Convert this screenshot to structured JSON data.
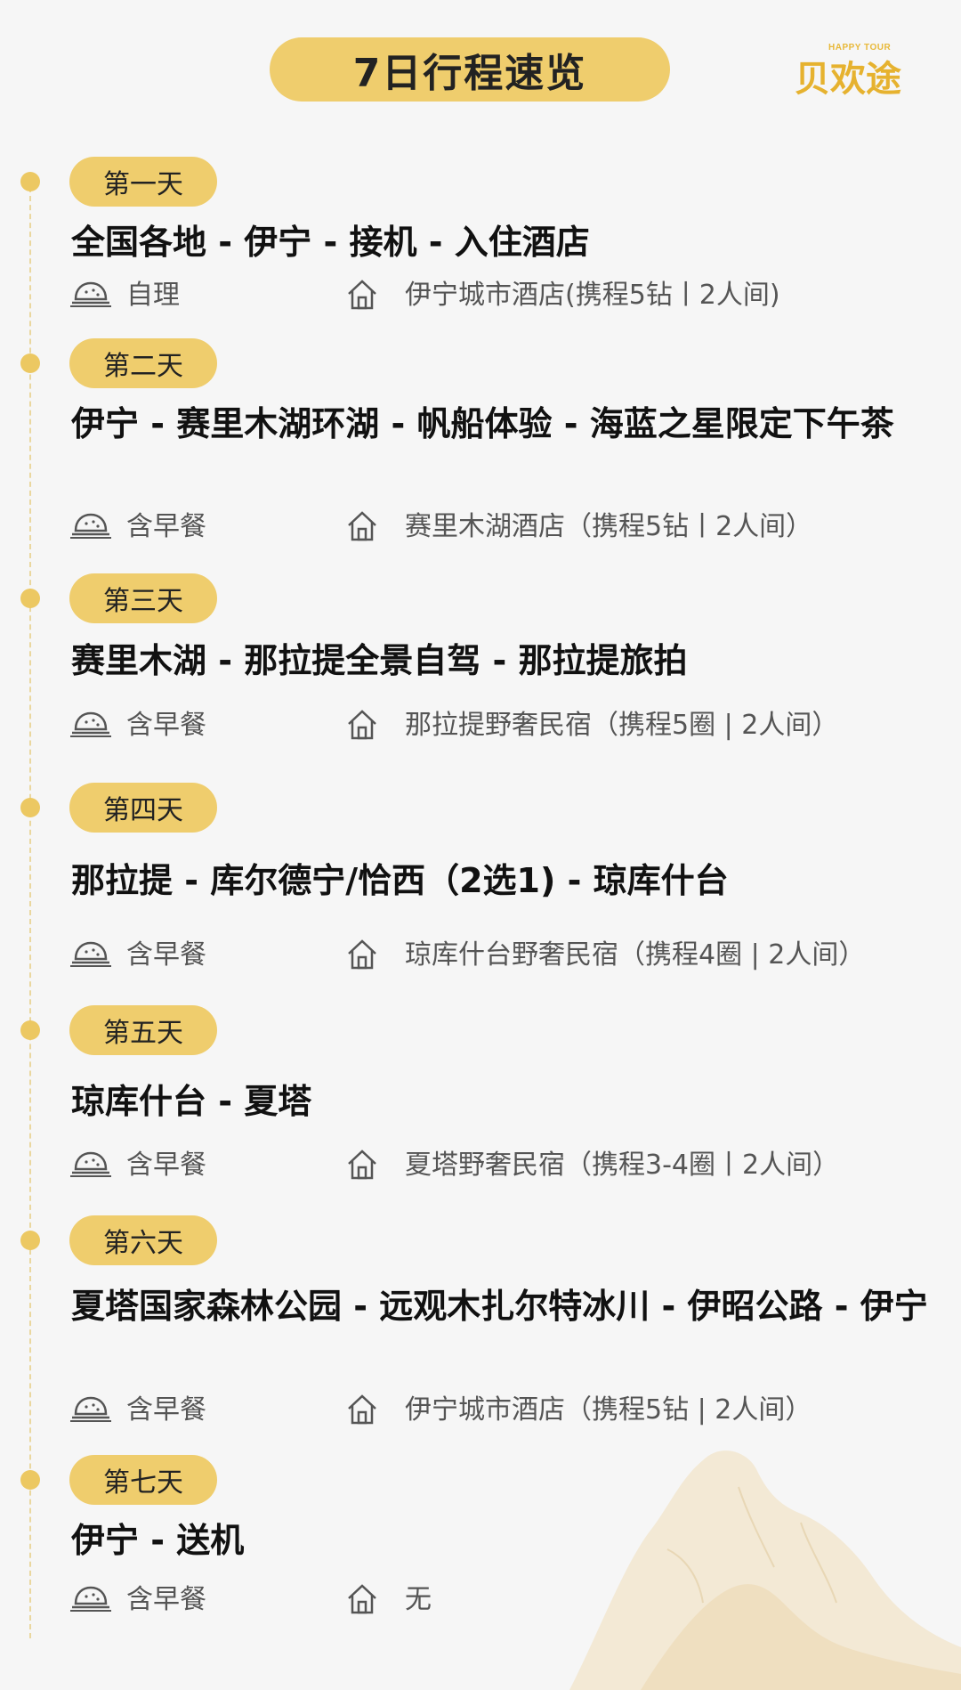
{
  "header": {
    "title": "7日行程速览",
    "logo_small": "HAPPY TOUR",
    "logo_text": "贝欢途"
  },
  "colors": {
    "accent": "#efcd6d",
    "dot": "#ecc862",
    "background": "#f6f6f6"
  },
  "days": [
    {
      "label": "第一天",
      "route": "全国各地 - 伊宁 - 接机 - 入住酒店",
      "meal": "自理",
      "hotel": "伊宁城市酒店(携程5钻丨2人间)"
    },
    {
      "label": "第二天",
      "route": "伊宁 -  赛里木湖环湖 - 帆船体验 - 海蓝之星限定下午茶",
      "meal": "含早餐",
      "hotel": "赛里木湖酒店（携程5钻丨2人间）"
    },
    {
      "label": "第三天",
      "route": "赛里木湖 - 那拉提全景自驾 - 那拉提旅拍",
      "meal": "含早餐",
      "hotel": "那拉提野奢民宿（携程5圈 | 2人间）"
    },
    {
      "label": "第四天",
      "route": "那拉提 - 库尔德宁/恰西（2选1) - 琼库什台",
      "meal": "含早餐",
      "hotel": "琼库什台野奢民宿（携程4圈  | 2人间）"
    },
    {
      "label": "第五天",
      "route": "琼库什台 - 夏塔",
      "meal": "含早餐",
      "hotel": "夏塔野奢民宿（携程3-4圈丨2人间）"
    },
    {
      "label": "第六天",
      "route": "夏塔国家森林公园 - 远观木扎尔特冰川 - 伊昭公路 - 伊宁",
      "meal": "含早餐",
      "hotel": "伊宁城市酒店（携程5钻 | 2人间）"
    },
    {
      "label": "第七天",
      "route": "伊宁 - 送机",
      "meal": "含早餐",
      "hotel": "无"
    }
  ]
}
